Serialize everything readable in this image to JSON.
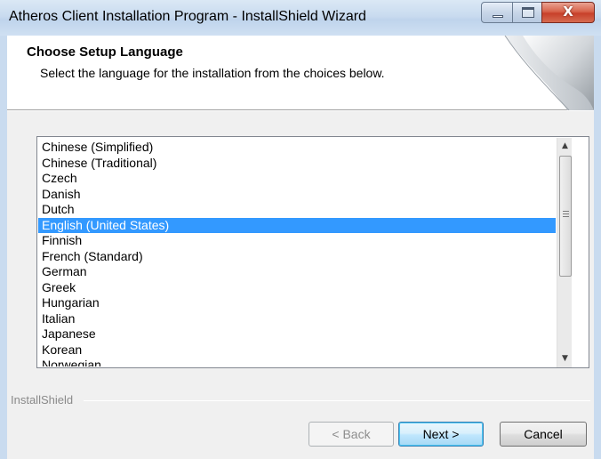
{
  "window": {
    "title": "Atheros Client Installation Program - InstallShield Wizard",
    "close_glyph": "X"
  },
  "header": {
    "title": "Choose Setup Language",
    "subtitle": "Select the language for the installation from the choices below."
  },
  "languages": {
    "items": [
      "Chinese (Simplified)",
      "Chinese (Traditional)",
      "Czech",
      "Danish",
      "Dutch",
      "English (United States)",
      "Finnish",
      "French (Standard)",
      "German",
      "Greek",
      "Hungarian",
      "Italian",
      "Japanese",
      "Korean",
      "Norwegian"
    ],
    "selected": "English (United States)"
  },
  "footer": {
    "brand": "InstallShield"
  },
  "buttons": {
    "back": "< Back",
    "next": "Next >",
    "cancel": "Cancel"
  },
  "colors": {
    "selection": "#3399ff",
    "titlebar": "#c9dbef",
    "close_button": "#c7402a"
  }
}
